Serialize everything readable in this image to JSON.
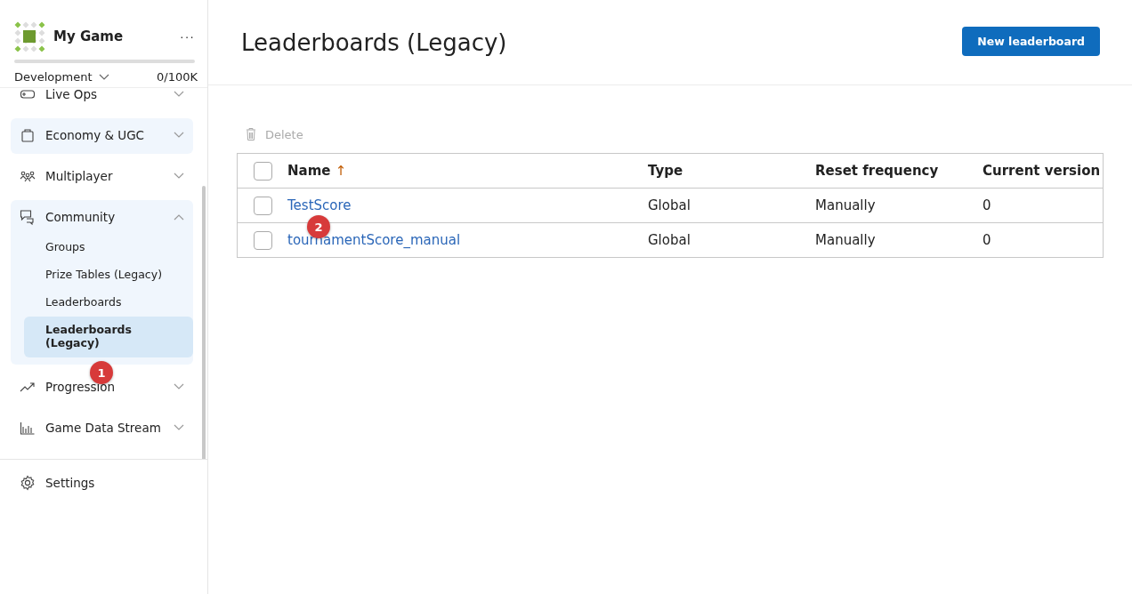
{
  "sidebar": {
    "game_title": "My Game",
    "more": "···",
    "usage": {
      "level": 0
    },
    "environment": "Development",
    "quota": "0/100K",
    "items": [
      {
        "label": "Live Ops",
        "kind": "gamepad",
        "highlighted": false,
        "expanded": false
      },
      {
        "label": "Economy & UGC",
        "kind": "bag",
        "highlighted": true,
        "expanded": false
      },
      {
        "label": "Multiplayer",
        "kind": "people",
        "highlighted": false,
        "expanded": false
      },
      {
        "label": "Community",
        "kind": "chat",
        "highlighted": true,
        "expanded": true,
        "children": [
          {
            "label": "Groups",
            "selected": false
          },
          {
            "label": "Prize Tables (Legacy)",
            "selected": false
          },
          {
            "label": "Leaderboards",
            "selected": false
          },
          {
            "label": "Leaderboards (Legacy)",
            "selected": true
          }
        ]
      },
      {
        "label": "Progression",
        "kind": "trend",
        "highlighted": false,
        "expanded": false
      },
      {
        "label": "Game Data Stream",
        "kind": "bars",
        "highlighted": false,
        "expanded": false
      }
    ],
    "settings": "Settings"
  },
  "page": {
    "title": "Leaderboards (Legacy)",
    "new_button": "New leaderboard",
    "delete": {
      "label": "Delete",
      "disabled": true
    }
  },
  "table": {
    "all_checked": false,
    "columns": [
      {
        "label": "Name",
        "sort": "↑"
      },
      {
        "label": "Type"
      },
      {
        "label": "Reset frequency"
      },
      {
        "label": "Current version"
      }
    ],
    "rows": [
      {
        "checked": false,
        "name": "TestScore",
        "type": "Global",
        "reset": "Manually",
        "version": "0"
      },
      {
        "checked": false,
        "name": "tournamentScore_manual",
        "type": "Global",
        "reset": "Manually",
        "version": "0"
      }
    ]
  },
  "annotations": [
    {
      "label": "1"
    },
    {
      "label": "2"
    }
  ]
}
